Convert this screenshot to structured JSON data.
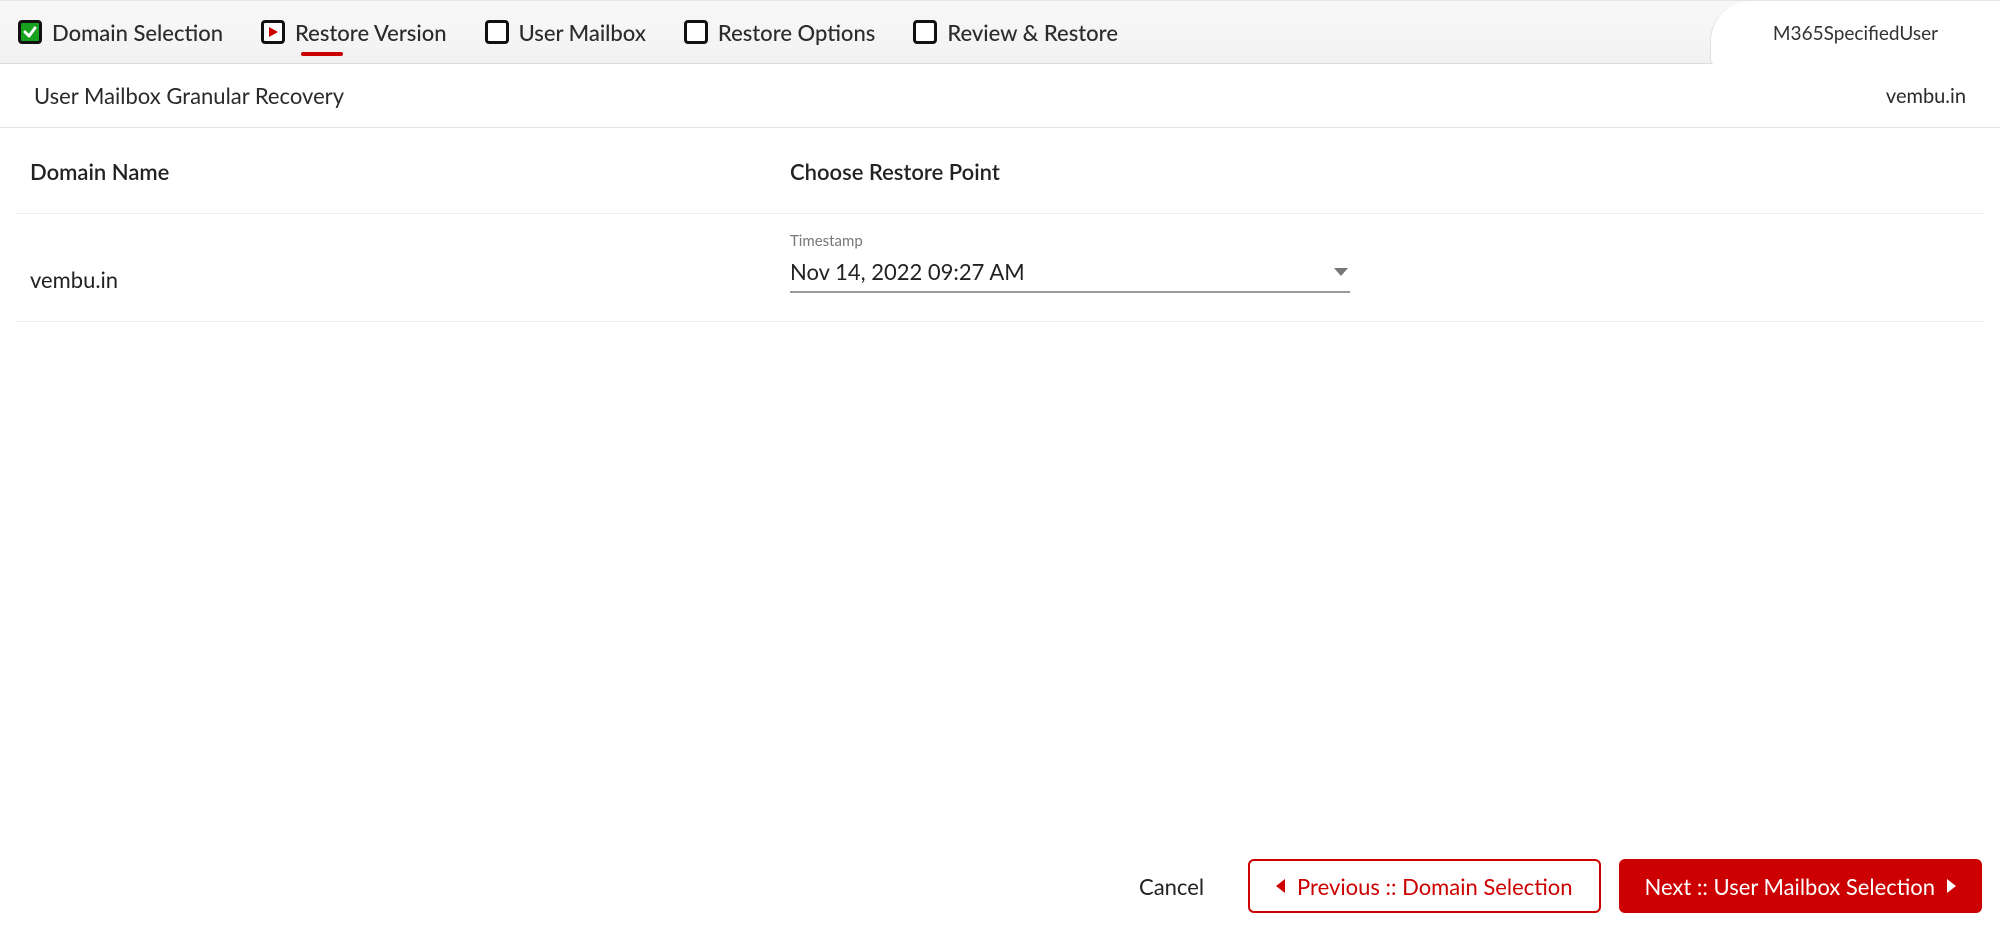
{
  "topbar": {
    "user_chip": "M365SpecifiedUser",
    "steps": [
      {
        "label": "Domain Selection",
        "state": "done"
      },
      {
        "label": "Restore Version",
        "state": "current"
      },
      {
        "label": "User Mailbox",
        "state": "pending"
      },
      {
        "label": "Restore Options",
        "state": "pending"
      },
      {
        "label": "Review & Restore",
        "state": "pending"
      }
    ]
  },
  "subheader": {
    "title": "User Mailbox Granular Recovery",
    "domain_right": "vembu.in"
  },
  "table": {
    "head_domain": "Domain Name",
    "head_restore": "Choose Restore Point",
    "rows": [
      {
        "domain": "vembu.in",
        "timestamp_label": "Timestamp",
        "timestamp_value": "Nov 14, 2022 09:27 AM"
      }
    ]
  },
  "footer": {
    "cancel": "Cancel",
    "previous": "Previous :: Domain Selection",
    "next": "Next :: User Mailbox Selection"
  },
  "colors": {
    "accent": "#cc0000",
    "done": "#18a01f"
  }
}
